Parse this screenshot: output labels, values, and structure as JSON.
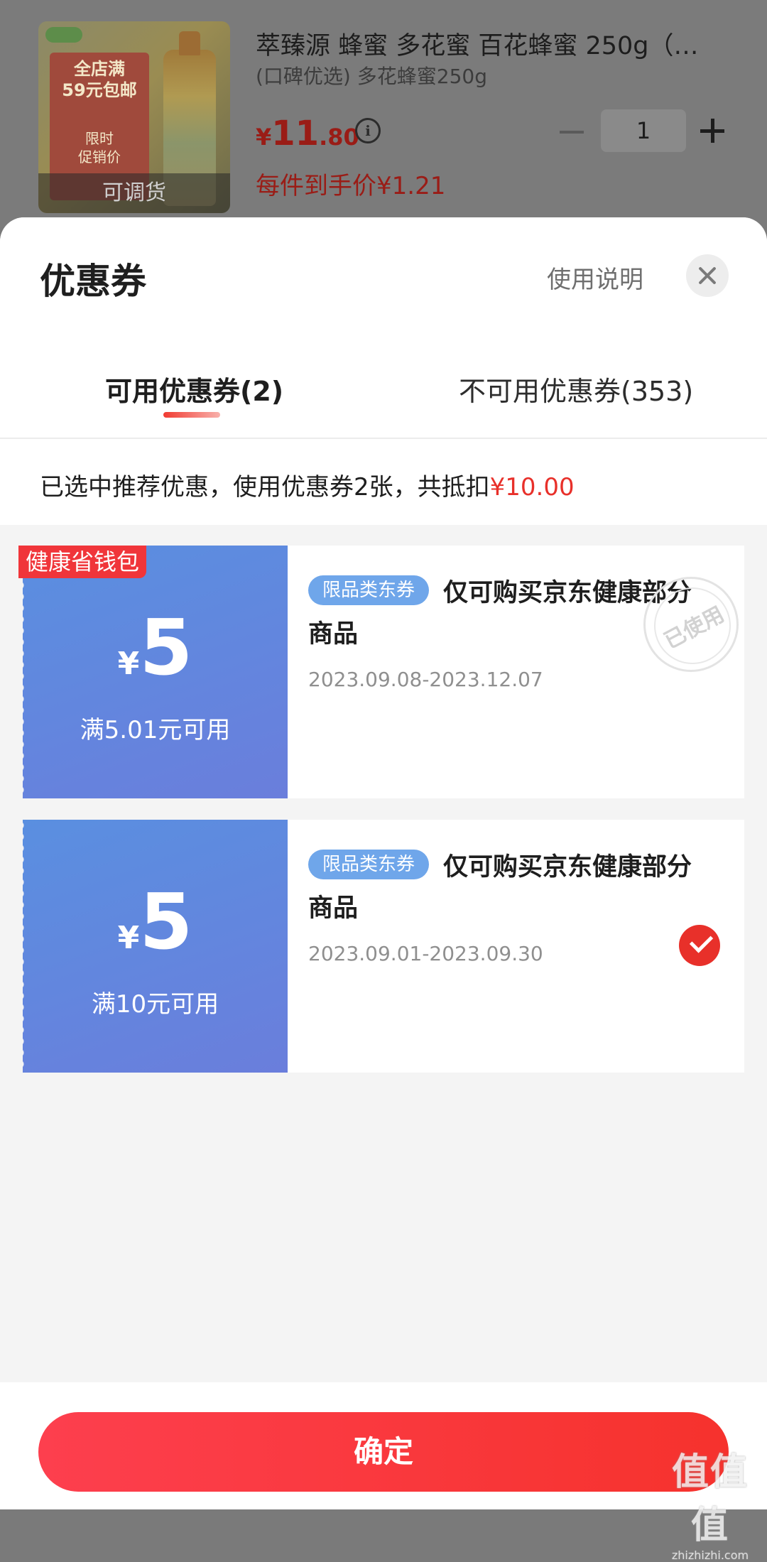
{
  "product": {
    "title": "萃臻源 蜂蜜 多花蜜 百花蜂蜜 250g（…",
    "spec": "(口碑优选) 多花蜂蜜250g",
    "price_currency": "¥",
    "price_int": "11",
    "price_dec": ".80",
    "per_price": "每件到手价¥1.21",
    "quantity": "1",
    "image_overlay": "可调货",
    "image_promo_line1": "全店满",
    "image_promo_line2": "59元包邮",
    "image_promo_line3": "限时",
    "image_promo_line4": "促销价"
  },
  "sheet": {
    "title": "优惠券",
    "help_label": "使用说明",
    "tabs": [
      {
        "label": "可用优惠券(2)"
      },
      {
        "label": "不可用优惠券(353)"
      }
    ],
    "summary_text": "已选中推荐优惠，使用优惠券2张，共抵扣",
    "summary_amount": "¥10.00"
  },
  "coupons": [
    {
      "ribbon": "健康省钱包",
      "currency": "¥",
      "amount": "5",
      "condition": "满5.01元可用",
      "badge": "限品类东券",
      "description": "仅可购买京东健康部分商品",
      "date_range": "2023.09.08-2023.12.07",
      "stamp": "已使用"
    },
    {
      "currency": "¥",
      "amount": "5",
      "condition": "满10元可用",
      "badge": "限品类东券",
      "description": "仅可购买京东健康部分商品",
      "date_range": "2023.09.01-2023.09.30"
    }
  ],
  "footer": {
    "confirm_label": "确定"
  },
  "watermark": {
    "main": "值值值",
    "sub": "zhizhizhi.com"
  },
  "colors": {
    "accent": "#e8302a",
    "coupon_blue": "#5a8fe0",
    "badge_blue": "#6fa6ea"
  }
}
